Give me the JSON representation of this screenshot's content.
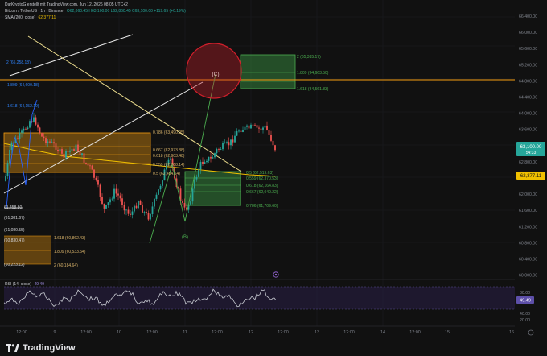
{
  "header": {
    "line1_prefix": "DarKryptoG erstellt mit TradingView.com, Jun 12, 2026 08:05 UTC+2",
    "line2_symbol": "Bitcoin / TetherUS · 1h · Binance",
    "ohlc": "O62,860.45 H63,100.00 L62,860.45 C63,100.00 +119.65 (+0.19%)",
    "sma_label": "SMA (200, close)",
    "sma_value": "62,377.11"
  },
  "price_axis": {
    "ticks": [
      "66,400.00",
      "66,000.00",
      "65,600.00",
      "65,200.00",
      "64,800.00",
      "64,400.00",
      "64,000.00",
      "63,600.00",
      "63,200.00",
      "62,800.00",
      "62,400.00",
      "62,000.00",
      "61,600.00",
      "61,200.00",
      "60,800.00",
      "60,400.00",
      "60,000.00"
    ],
    "current_price": "63,100.00",
    "current_countdown": "54:33",
    "sma_badge": "62,377.11"
  },
  "rsi": {
    "label": "RSI (14, close)",
    "value": "49.49",
    "ticks": [
      "80.00",
      "60.00",
      "40.00",
      "20.00"
    ],
    "badge": "49.49"
  },
  "time_axis": {
    "labels": [
      "12:00",
      "9",
      "12:00",
      "10",
      "12:00",
      "11",
      "12:00",
      "12",
      "12:00",
      "13",
      "12:00",
      "14",
      "12:00",
      "15",
      "16"
    ]
  },
  "annotations": {
    "fib_left_top": [
      "2 (65,258.18)",
      "1.809 (64,600.18)",
      "1.618 (64,152.19)"
    ],
    "fib_orange_box": [
      "0.786 (63,490.05)",
      "0.667 (62,973.88)",
      "0.618 (62,903.48)",
      "0.559 (62,708.14)",
      "0.5 (62,494.64)"
    ],
    "fib_green_right": [
      "2 (65,385.17)",
      "1.809 (64,663.50)",
      "1.618 (64,561.83)"
    ],
    "fib_green_lower": [
      "0.5 (62,519.63)",
      "0.559 (62,370.53)",
      "0.618 (62,164.83)",
      "0.667 (62,040.22)",
      "0.786 (61,709.60)"
    ],
    "fib_bottom_left": [
      "1.618 (60,862.43)",
      "1.809 (60,533.54)",
      "2 (60,184.64)"
    ],
    "left_prices": [
      "61,458.80",
      "(61,381.67)",
      "(61,080.55)",
      "(60,830.47)",
      "(60,223.12)"
    ],
    "wave_c": "(C)",
    "wave_b": "(B)"
  },
  "footer": {
    "brand": "TradingView"
  },
  "colors": {
    "background": "#111111",
    "up": "#26a69a",
    "down": "#ef5350",
    "orange_zone": "#f59d0f",
    "green_zone": "#3c9a44",
    "sma_line": "#f0c000",
    "rsi_line": "#c8cbd2",
    "circle_red": "#d11f2b"
  }
}
